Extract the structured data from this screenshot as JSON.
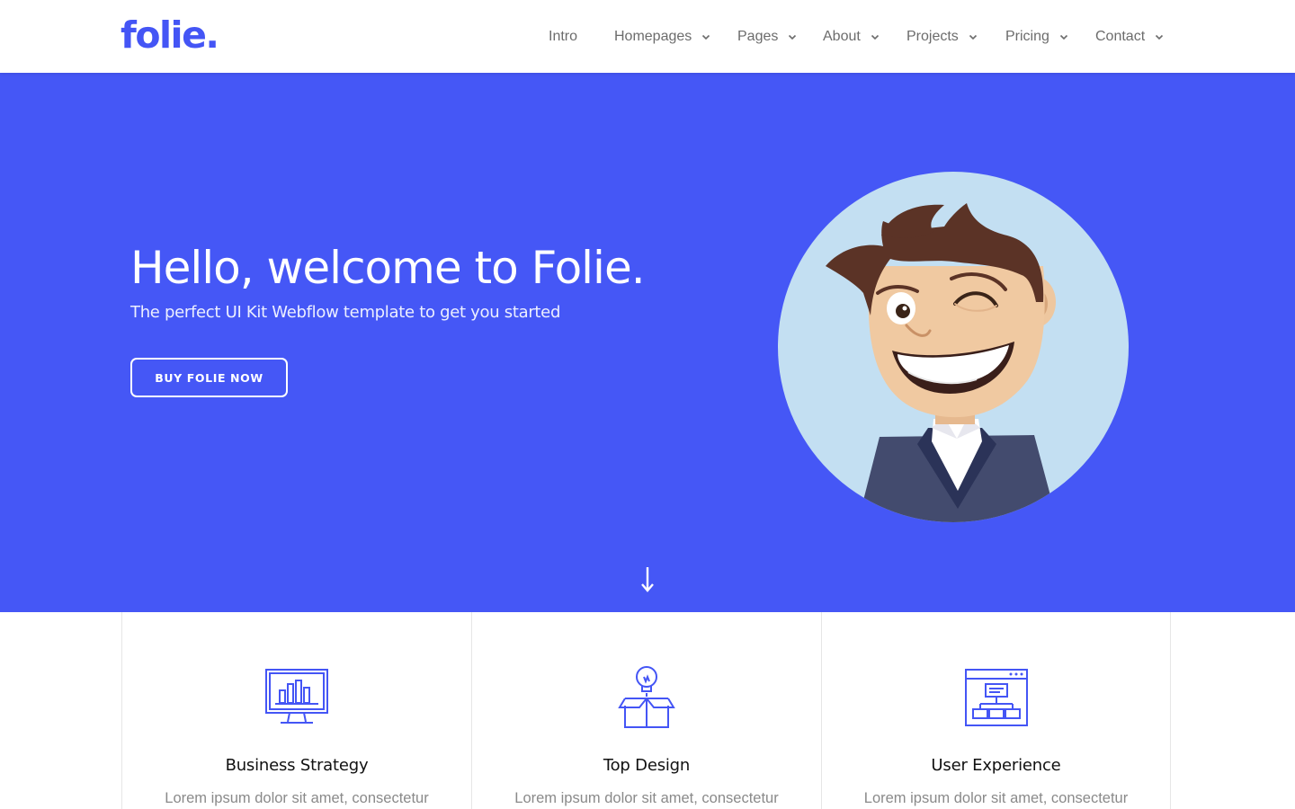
{
  "header": {
    "logo": "folie.",
    "nav": [
      {
        "label": "Intro",
        "has_dropdown": false
      },
      {
        "label": "Homepages",
        "has_dropdown": true
      },
      {
        "label": "Pages",
        "has_dropdown": true
      },
      {
        "label": "About",
        "has_dropdown": true
      },
      {
        "label": "Projects",
        "has_dropdown": true
      },
      {
        "label": "Pricing",
        "has_dropdown": true
      },
      {
        "label": "Contact",
        "has_dropdown": true
      }
    ]
  },
  "hero": {
    "title": "Hello, welcome to Folie.",
    "subtitle": "The perfect UI Kit Webflow template to get you started",
    "button_label": "BUY FOLIE NOW",
    "illustration": "winking-cartoon-man-avatar",
    "scroll_icon": "arrow-down-icon"
  },
  "features": [
    {
      "icon": "monitor-bar-chart-icon",
      "title": "Business Strategy",
      "text": "Lorem ipsum dolor sit amet, consectetur"
    },
    {
      "icon": "lightbulb-box-icon",
      "title": "Top Design",
      "text": "Lorem ipsum dolor sit amet, consectetur"
    },
    {
      "icon": "browser-sitemap-icon",
      "title": "User Experience",
      "text": "Lorem ipsum dolor sit amet, consectetur"
    }
  ],
  "colors": {
    "brand": "#4455f5",
    "hero_bg": "#4557f6",
    "nav_text": "#6c6c6c",
    "body_text": "#8a8a8a"
  }
}
